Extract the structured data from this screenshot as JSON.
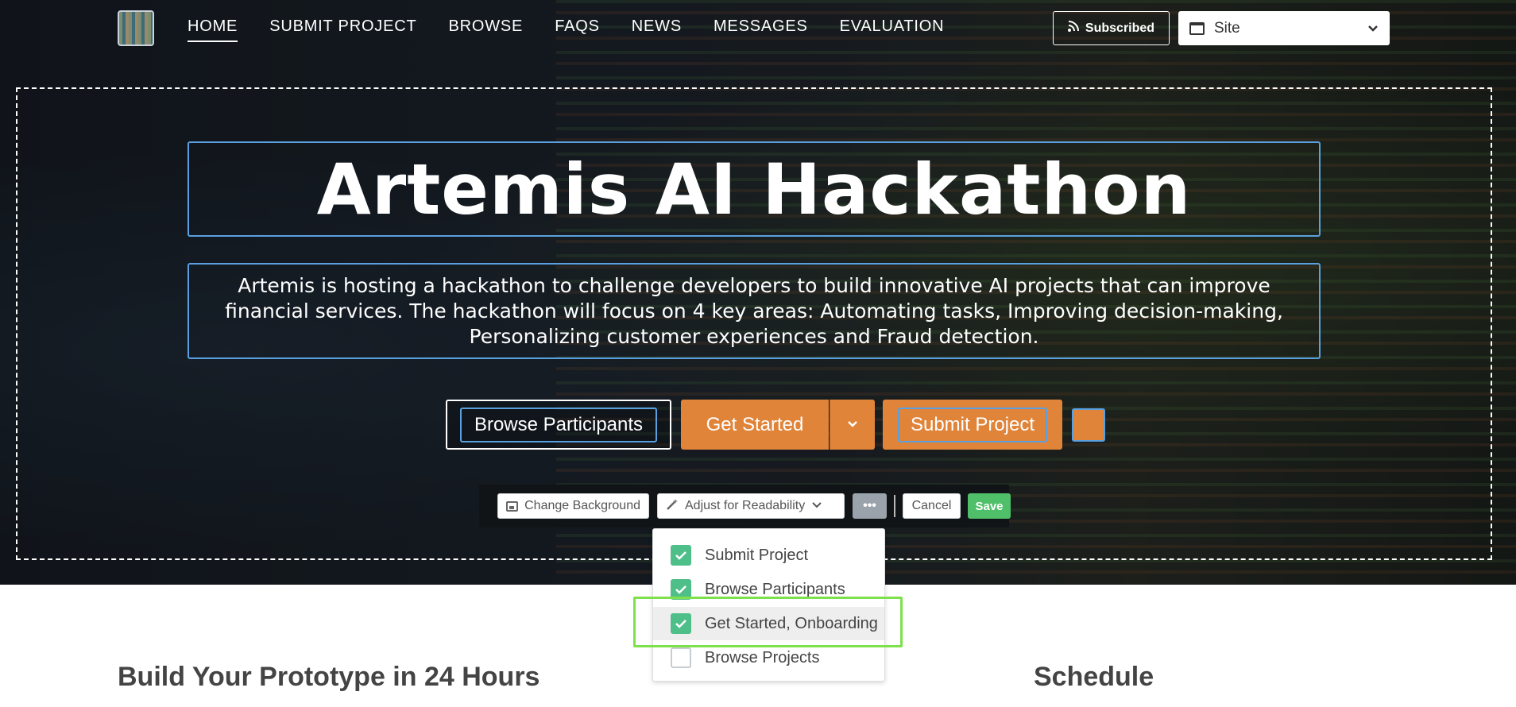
{
  "nav": {
    "links": [
      "HOME",
      "SUBMIT PROJECT",
      "BROWSE",
      "FAQS",
      "NEWS",
      "MESSAGES",
      "EVALUATION"
    ],
    "subscribed_label": "Subscribed",
    "site_select_value": "Site"
  },
  "hero": {
    "title": "Artemis AI Hackathon",
    "description": "Artemis is hosting a hackathon to challenge developers to build innovative AI projects that can improve financial services. The hackathon will focus on 4 key areas: Automating tasks, Improving decision-making, Personalizing customer experiences and Fraud detection.",
    "buttons": {
      "browse_participants": "Browse Participants",
      "get_started": "Get Started",
      "submit_project": "Submit Project"
    }
  },
  "toolbar": {
    "change_background": "Change Background",
    "adjust_readability": "Adjust for Readability",
    "more": "•••",
    "cancel": "Cancel",
    "save": "Save"
  },
  "dropdown": {
    "items": [
      {
        "label": "Submit Project",
        "checked": true
      },
      {
        "label": "Browse Participants",
        "checked": true
      },
      {
        "label": "Get Started, Onboarding",
        "checked": true
      },
      {
        "label": "Browse Projects",
        "checked": false
      }
    ]
  },
  "sections": {
    "left_heading": "Build Your Prototype in 24 Hours",
    "right_heading": "Schedule"
  },
  "colors": {
    "accent_orange": "#e0843a",
    "selection_blue": "#5aa0e0",
    "save_green": "#4fbf6a",
    "check_green": "#4fbf8a",
    "highlight_green": "#7ee04a"
  }
}
